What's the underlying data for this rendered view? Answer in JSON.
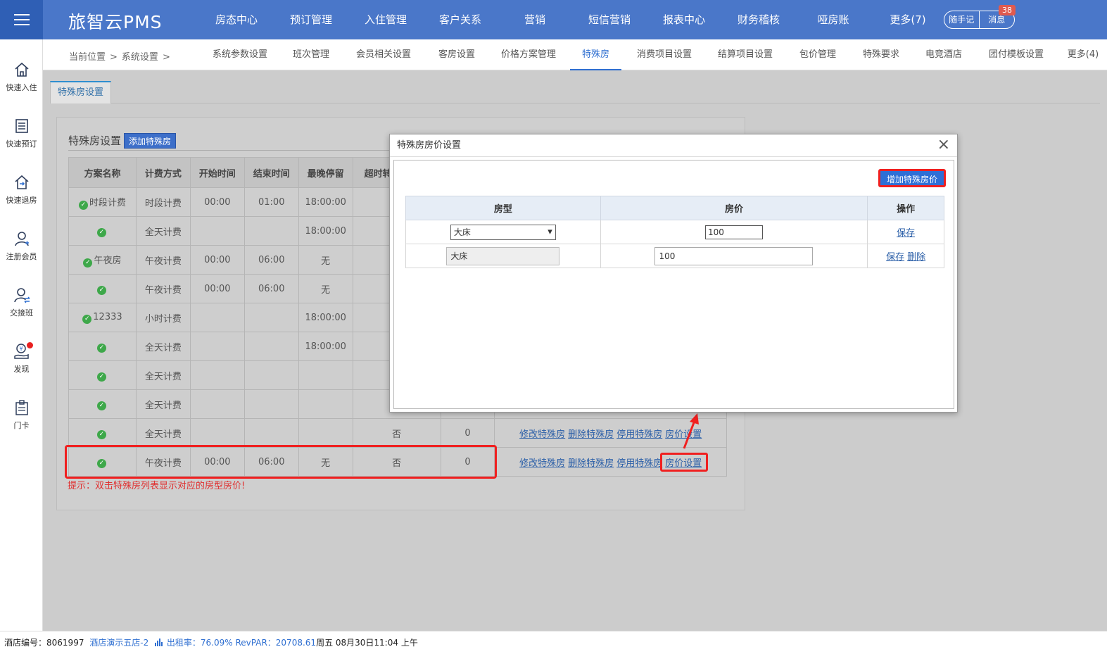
{
  "app": {
    "brand": "旅智云PMS",
    "top_nav": [
      "房态中心",
      "预订管理",
      "入住管理",
      "客户关系",
      "营销",
      "短信营销",
      "报表中心",
      "财务稽核",
      "哑房账",
      "更多(7)"
    ],
    "memo_label": "随手记",
    "message_label": "消息",
    "message_count": "38"
  },
  "sidebar": {
    "items": [
      {
        "label": "快速入住",
        "icon": "home-icon"
      },
      {
        "label": "快速预订",
        "icon": "list-icon"
      },
      {
        "label": "快速退房",
        "icon": "checkout-icon"
      },
      {
        "label": "注册会员",
        "icon": "user-icon"
      },
      {
        "label": "交接班",
        "icon": "user-swap-icon"
      },
      {
        "label": "发现",
        "icon": "coin-hand-icon"
      },
      {
        "label": "门卡",
        "icon": "card-icon"
      }
    ]
  },
  "subnav": {
    "breadcrumb": [
      "当前位置",
      ">",
      "系统设置",
      ">"
    ],
    "items": [
      "系统参数设置",
      "班次管理",
      "会员相关设置",
      "客房设置",
      "价格方案管理",
      "特殊房",
      "消费项目设置",
      "结算项目设置",
      "包价管理",
      "特殊要求",
      "电竞酒店",
      "团付模板设置",
      "更多(4)"
    ],
    "active": "特殊房"
  },
  "page": {
    "tab": "特殊房设置",
    "panel_title": "特殊房设置",
    "add_button": "添加特殊房",
    "hint": "提示：双击特殊房列表显示对应的房型房价!",
    "table": {
      "headers": [
        "方案名称",
        "计费方式",
        "开始时间",
        "结束时间",
        "最晚停留",
        "超时转",
        "",
        ""
      ],
      "rows": [
        {
          "name": "时段计费",
          "mode": "时段计费",
          "start": "00:00",
          "end": "01:00",
          "latest": "18:00:00",
          "over": "",
          "num": "",
          "ops": []
        },
        {
          "name": "",
          "mode": "全天计费",
          "start": "",
          "end": "",
          "latest": "18:00:00",
          "over": "",
          "num": "",
          "ops": []
        },
        {
          "name": "午夜房",
          "mode": "午夜计费",
          "start": "00:00",
          "end": "06:00",
          "latest": "无",
          "over": "",
          "num": "",
          "ops": []
        },
        {
          "name": "",
          "mode": "午夜计费",
          "start": "00:00",
          "end": "06:00",
          "latest": "无",
          "over": "",
          "num": "",
          "ops": []
        },
        {
          "name": "12333",
          "mode": "小时计费",
          "start": "",
          "end": "",
          "latest": "18:00:00",
          "over": "",
          "num": "",
          "ops": []
        },
        {
          "name": "",
          "mode": "全天计费",
          "start": "",
          "end": "",
          "latest": "18:00:00",
          "over": "",
          "num": "",
          "ops": []
        },
        {
          "name": "",
          "mode": "全天计费",
          "start": "",
          "end": "",
          "latest": "",
          "over": "",
          "num": "",
          "ops": []
        },
        {
          "name": "",
          "mode": "全天计费",
          "start": "",
          "end": "",
          "latest": "",
          "over": "",
          "num": "",
          "ops": []
        },
        {
          "name": "",
          "mode": "全天计费",
          "start": "",
          "end": "",
          "latest": "",
          "over": "否",
          "num": "0",
          "ops": [
            "修改特殊房",
            "删除特殊房",
            "停用特殊房",
            "房价设置"
          ]
        },
        {
          "name": "",
          "mode": "午夜计费",
          "start": "00:00",
          "end": "06:00",
          "latest": "无",
          "over": "否",
          "num": "0",
          "ops": [
            "修改特殊房",
            "删除特殊房",
            "停用特殊房",
            "房价设置"
          ]
        }
      ]
    }
  },
  "modal": {
    "title": "特殊房房价设置",
    "add_button": "增加特殊房价",
    "headers": [
      "房型",
      "房价",
      "操作"
    ],
    "rows": [
      {
        "room_type": "大床",
        "price": "100",
        "ops": [
          "保存"
        ]
      },
      {
        "room_type": "大床",
        "price": "100",
        "ops": [
          "保存",
          "删除"
        ]
      }
    ]
  },
  "status": {
    "hotel_code_label": "酒店编号：",
    "hotel_code": "8061997",
    "hotel_name": "酒店演示五店-2",
    "occupancy": "出租率：76.09% RevPAR：20708.61",
    "datetime": "周五 08月30日11:04 上午"
  }
}
